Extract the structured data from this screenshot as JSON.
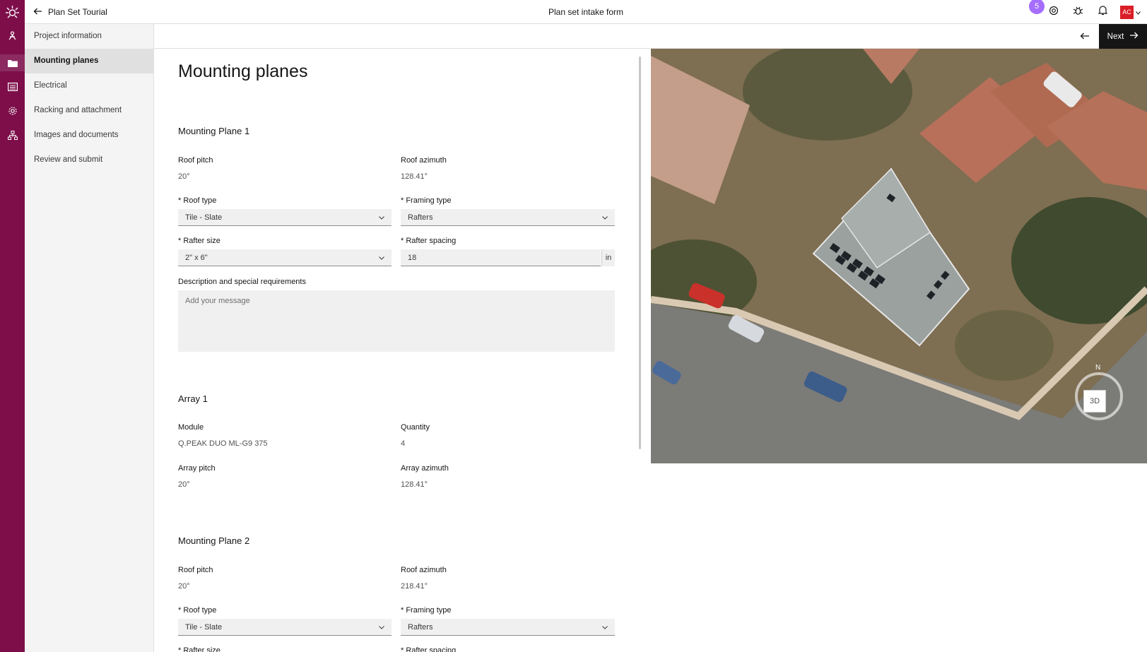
{
  "header": {
    "back_label": "Plan Set Tourial",
    "title": "Plan set intake form",
    "notification_count": "5",
    "avatar_initials": "AC"
  },
  "sidenav": {
    "items": [
      {
        "label": "Project information"
      },
      {
        "label": "Mounting planes"
      },
      {
        "label": "Electrical"
      },
      {
        "label": "Racking and attachment"
      },
      {
        "label": "Images and documents"
      },
      {
        "label": "Review and submit"
      }
    ],
    "active_index": 1
  },
  "subbar": {
    "next_label": "Next"
  },
  "form": {
    "page_title": "Mounting planes",
    "plane1": {
      "title": "Mounting Plane 1",
      "roof_pitch_label": "Roof pitch",
      "roof_pitch": "20°",
      "roof_azimuth_label": "Roof azimuth",
      "roof_azimuth": "128.41°",
      "roof_type_label": "* Roof type",
      "roof_type": "Tile - Slate",
      "framing_type_label": "* Framing type",
      "framing_type": "Rafters",
      "rafter_size_label": "* Rafter size",
      "rafter_size": "2\" x 6\"",
      "rafter_spacing_label": "* Rafter spacing",
      "rafter_spacing": "18",
      "rafter_spacing_unit": "in",
      "description_label": "Description and special requirements",
      "description_placeholder": "Add your message"
    },
    "array1": {
      "title": "Array 1",
      "module_label": "Module",
      "module": "Q.PEAK DUO ML-G9 375",
      "quantity_label": "Quantity",
      "quantity": "4",
      "array_pitch_label": "Array pitch",
      "array_pitch": "20°",
      "array_azimuth_label": "Array azimuth",
      "array_azimuth": "128.41°"
    },
    "plane2": {
      "title": "Mounting Plane 2",
      "roof_pitch_label": "Roof pitch",
      "roof_pitch": "20°",
      "roof_azimuth_label": "Roof azimuth",
      "roof_azimuth": "218.41°",
      "roof_type_label": "* Roof type",
      "roof_type": "Tile - Slate",
      "framing_type_label": "* Framing type",
      "framing_type": "Rafters",
      "rafter_size_label": "* Rafter size",
      "rafter_spacing_label": "* Rafter spacing"
    }
  },
  "map": {
    "compass_label": "N",
    "view_toggle": "3D"
  },
  "colors": {
    "rail": "#7d0e4a",
    "accent_badge": "#a56eff",
    "avatar": "#da1e28",
    "next_button": "#161616"
  }
}
